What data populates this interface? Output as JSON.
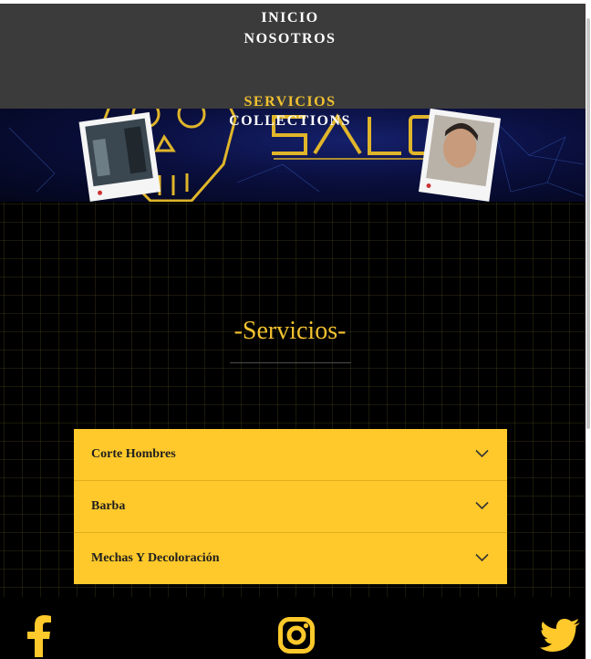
{
  "nav": {
    "items": [
      {
        "label": "INICIO",
        "active": false
      },
      {
        "label": "NOSOTROS",
        "active": false
      },
      {
        "label": "SERVICIOS",
        "active": true
      },
      {
        "label": "COLLECTIONS",
        "active": false
      }
    ]
  },
  "banner": {
    "logo_text": "SALON",
    "icons": [
      "skull-logo-icon",
      "photo-card-left",
      "photo-card-right"
    ]
  },
  "main": {
    "title": "-Servicios-",
    "services": [
      {
        "label": "Corte Hombres",
        "icon": "chevron-down-icon"
      },
      {
        "label": "Barba",
        "icon": "chevron-down-icon"
      },
      {
        "label": "Mechas Y Decoloración",
        "icon": "chevron-down-icon"
      }
    ]
  },
  "footer": {
    "social": [
      "facebook-icon",
      "instagram-icon",
      "twitter-icon"
    ]
  },
  "colors": {
    "accent": "#ffc92b",
    "title": "#f2c230",
    "nav_bg": "#3b3b3b",
    "page_bg": "#000000"
  }
}
